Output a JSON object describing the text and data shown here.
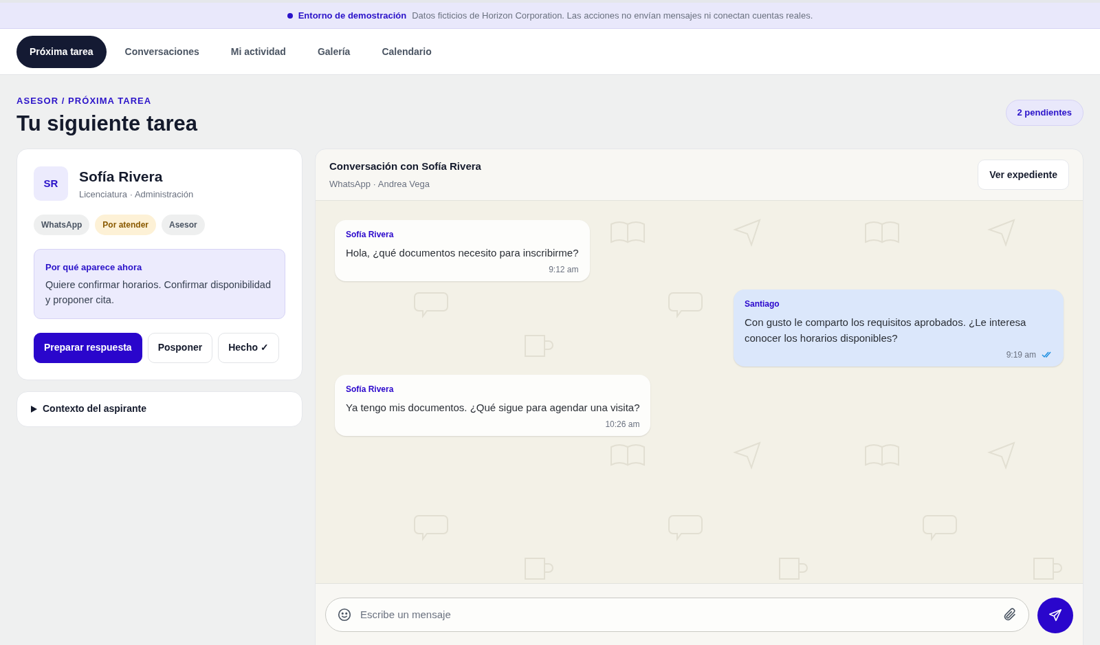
{
  "banner": {
    "label": "Entorno de demostración",
    "text": "Datos ficticios de Horizon Corporation. Las acciones no envían mensajes ni conectan cuentas reales."
  },
  "tabs": [
    {
      "label": "Próxima tarea",
      "selected": true
    },
    {
      "label": "Conversaciones",
      "selected": false
    },
    {
      "label": "Mi actividad",
      "selected": false
    },
    {
      "label": "Galería",
      "selected": false
    },
    {
      "label": "Calendario",
      "selected": false
    }
  ],
  "breadcrumb": "ASESOR / PRÓXIMA TAREA",
  "title": "Tu siguiente tarea",
  "pending_badge": "2 pendientes",
  "contact": {
    "initials": "SR",
    "name": "Sofía Rivera",
    "subtitle": "Licenciatura · Administración",
    "tags": [
      {
        "label": "WhatsApp",
        "kind": "neutral"
      },
      {
        "label": "Por atender",
        "kind": "warning"
      },
      {
        "label": "Asesor",
        "kind": "neutral"
      }
    ],
    "reason_title": "Por qué aparece ahora",
    "reason_text": "Quiere confirmar horarios. Confirmar disponibilidad y proponer cita.",
    "actions": [
      {
        "label": "Preparar respuesta",
        "kind": "primary"
      },
      {
        "label": "Posponer",
        "kind": "secondary"
      },
      {
        "label": "Hecho ✓",
        "kind": "secondary"
      }
    ]
  },
  "context": {
    "label": "Contexto del aspirante",
    "expanded": false
  },
  "conversation": {
    "title": "Conversación con Sofía Rivera",
    "subtitle": "WhatsApp · Andrea Vega",
    "button": "Ver expediente",
    "messages": [
      {
        "sender": "Sofía Rivera",
        "text": "Hola, ¿qué documentos necesito para inscribirme?",
        "time": "9:12 am",
        "outgoing": false
      },
      {
        "sender": "Santiago",
        "text": "Con gusto le comparto los requisitos aprobados. ¿Le interesa conocer los horarios disponibles?",
        "time": "9:19 am",
        "outgoing": true,
        "read": true
      },
      {
        "sender": "Sofía Rivera",
        "text": "Ya tengo mis documentos. ¿Qué sigue para agendar una visita?",
        "time": "10:26 am",
        "outgoing": false
      }
    ],
    "composer": {
      "placeholder": "Escribe un mensaje"
    }
  }
}
